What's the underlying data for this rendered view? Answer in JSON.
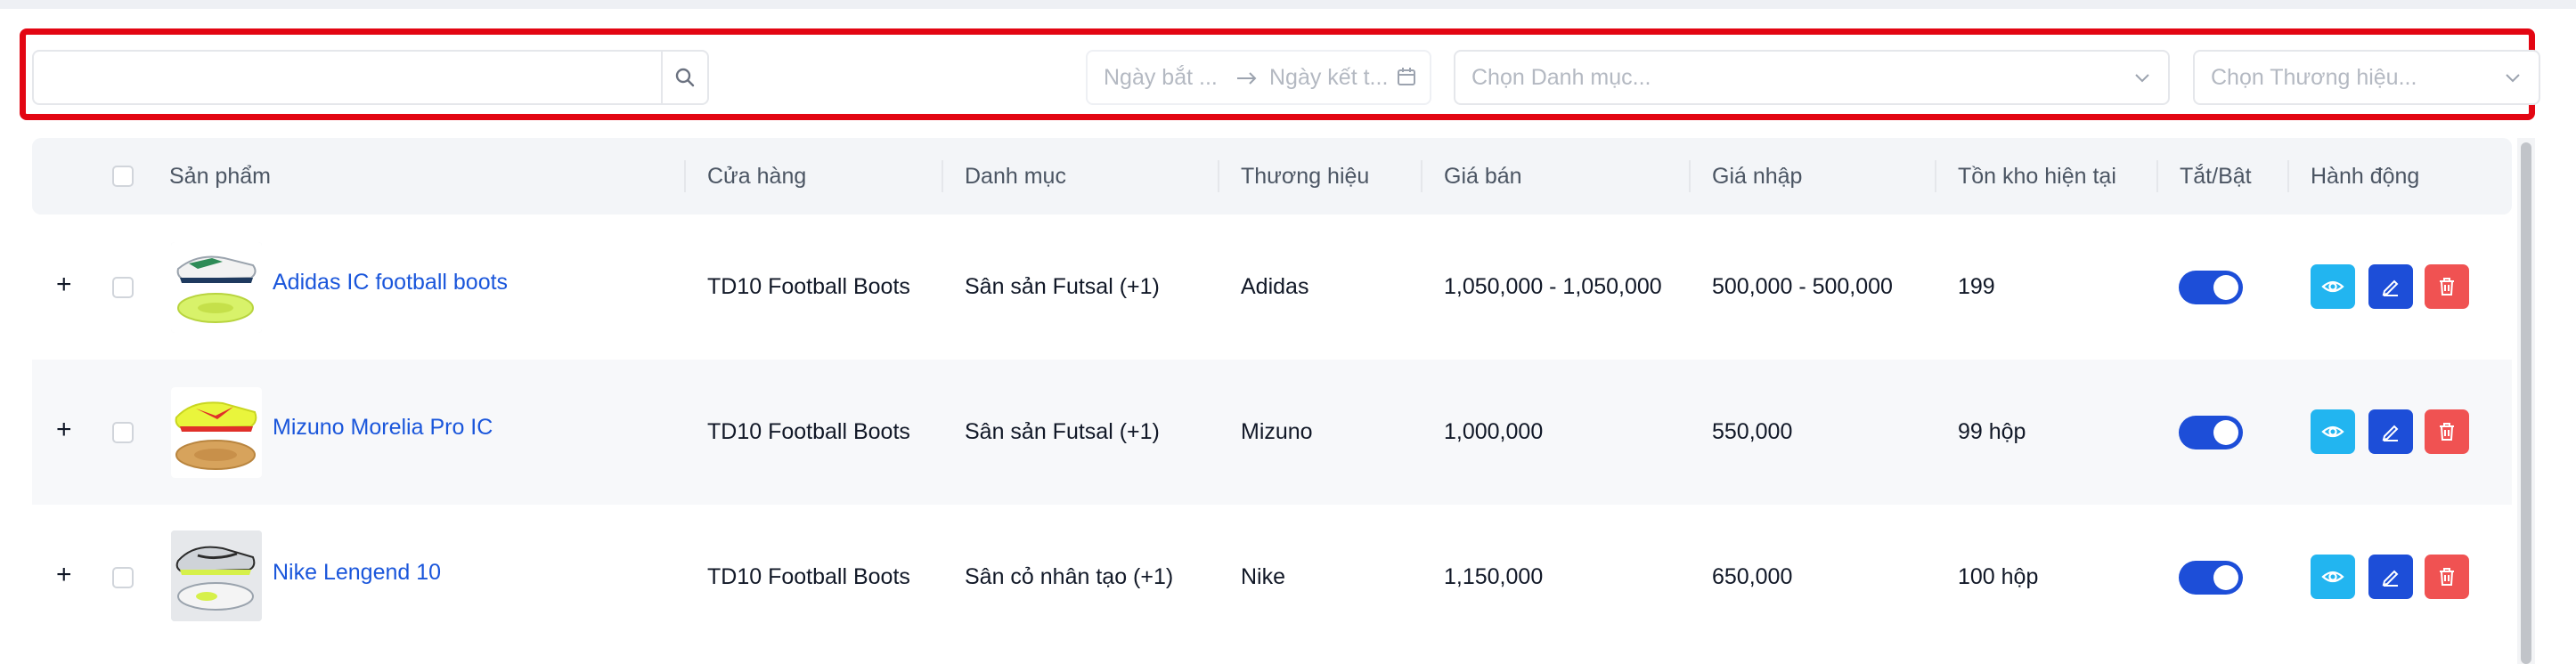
{
  "filters": {
    "search_placeholder": "",
    "date_start_placeholder": "Ngày bắt ...",
    "date_end_placeholder": "Ngày kết t...",
    "category_placeholder": "Chọn Danh mục...",
    "brand_placeholder": "Chọn Thương hiệu..."
  },
  "table": {
    "columns": [
      "Sản phẩm",
      "Cửa hàng",
      "Danh mục",
      "Thương hiệu",
      "Giá bán",
      "Giá nhập",
      "Tồn kho hiện tại",
      "Tắt/Bật",
      "Hành động"
    ],
    "rows": [
      {
        "expand": "+",
        "name": "Adidas IC football boots",
        "store": "TD10 Football Boots",
        "category": "Sân sản Futsal (+1)",
        "brand": "Adidas",
        "price": "1,050,000 - 1,050,000",
        "cost": "500,000 - 500,000",
        "stock": "199",
        "enabled": true
      },
      {
        "expand": "+",
        "name": "Mizuno Morelia Pro IC",
        "store": "TD10 Football Boots",
        "category": "Sân sản Futsal (+1)",
        "brand": "Mizuno",
        "price": "1,000,000",
        "cost": "550,000",
        "stock": "99 hộp",
        "enabled": true
      },
      {
        "expand": "+",
        "name": "Nike Lengend 10",
        "store": "TD10 Football Boots",
        "category": "Sân cỏ nhân tạo (+1)",
        "brand": "Nike",
        "price": "1,150,000",
        "cost": "650,000",
        "stock": "100 hộp",
        "enabled": true
      }
    ]
  },
  "colors": {
    "highlight_frame": "#e30613",
    "toggle_on": "#1d4ed8",
    "view_button": "#22b5f0",
    "edit_button": "#1d4ed8",
    "delete_button": "#f05252",
    "link": "#1a56db"
  },
  "icons": {
    "search": "search-icon",
    "calendar": "calendar-icon",
    "arrow": "arrow-right-icon",
    "chevron": "chevron-down-icon",
    "view": "eye-icon",
    "edit": "pencil-icon",
    "delete": "trash-icon"
  }
}
